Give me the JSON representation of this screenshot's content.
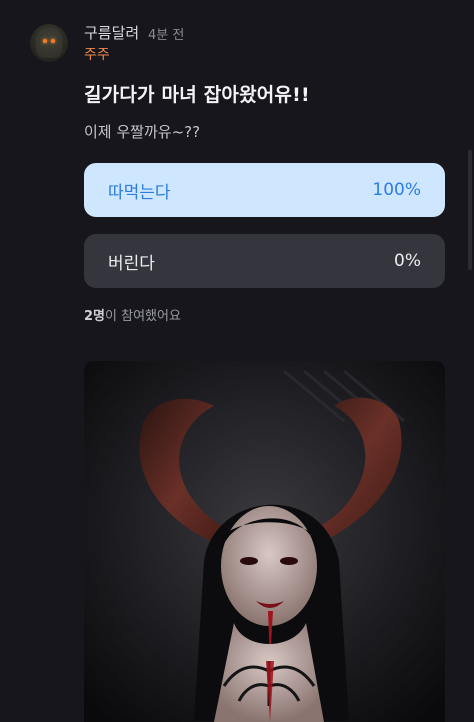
{
  "post": {
    "author": "구름달려",
    "time": "4분 전",
    "tag": "주주",
    "title": "길가다가 마녀 잡아왔어유!!",
    "body": "이제 우짤까유~??"
  },
  "poll": {
    "options": [
      {
        "label": "따먹는다",
        "percent": "100%",
        "selected": true
      },
      {
        "label": "버린다",
        "percent": "0%",
        "selected": false
      }
    ],
    "participants_count": "2명",
    "participants_suffix": "이 참여했어요"
  },
  "colors": {
    "background": "#16161c",
    "selected_option_bg": "#cfe6ff",
    "selected_option_text": "#2b7de0",
    "unselected_option_bg": "#35353d",
    "tag": "#f0894a"
  },
  "icons": {
    "avatar": "hooded-figure-glowing-eyes"
  }
}
